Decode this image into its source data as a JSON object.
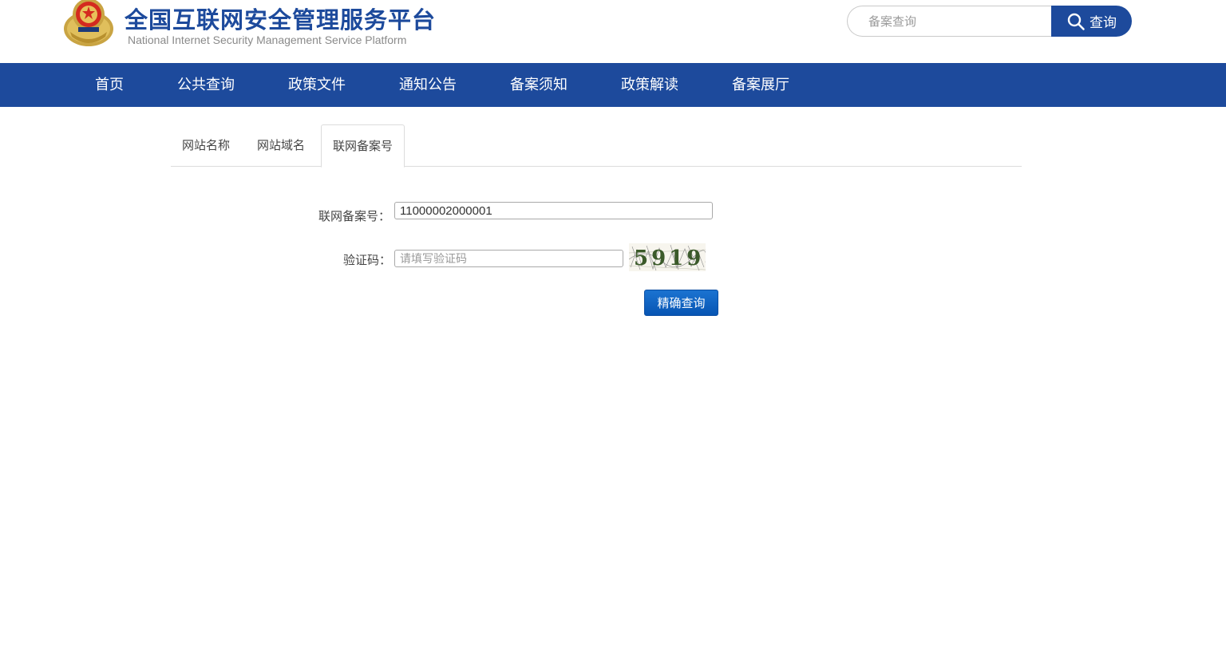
{
  "header": {
    "title": "全国互联网安全管理服务平台",
    "subtitle": "National Internet Security Management Service Platform",
    "search": {
      "placeholder": "备案查询",
      "button_label": "查询"
    }
  },
  "nav": {
    "items": [
      {
        "label": "首页"
      },
      {
        "label": "公共查询"
      },
      {
        "label": "政策文件"
      },
      {
        "label": "通知公告"
      },
      {
        "label": "备案须知"
      },
      {
        "label": "政策解读"
      },
      {
        "label": "备案展厅"
      }
    ]
  },
  "tabs": [
    {
      "label": "网站名称",
      "active": false
    },
    {
      "label": "网站域名",
      "active": false
    },
    {
      "label": "联网备案号",
      "active": true
    }
  ],
  "form": {
    "record_label": "联网备案号：",
    "record_value": "11000002000001",
    "captcha_label": "验证码：",
    "captcha_placeholder": "请填写验证码",
    "captcha_text": "5919",
    "submit_label": "精确查询"
  },
  "colors": {
    "brand_blue": "#1d4a9c",
    "button_blue": "#0b5fc2"
  },
  "icons": {
    "emblem": "national-emblem-icon",
    "search": "search-icon"
  }
}
